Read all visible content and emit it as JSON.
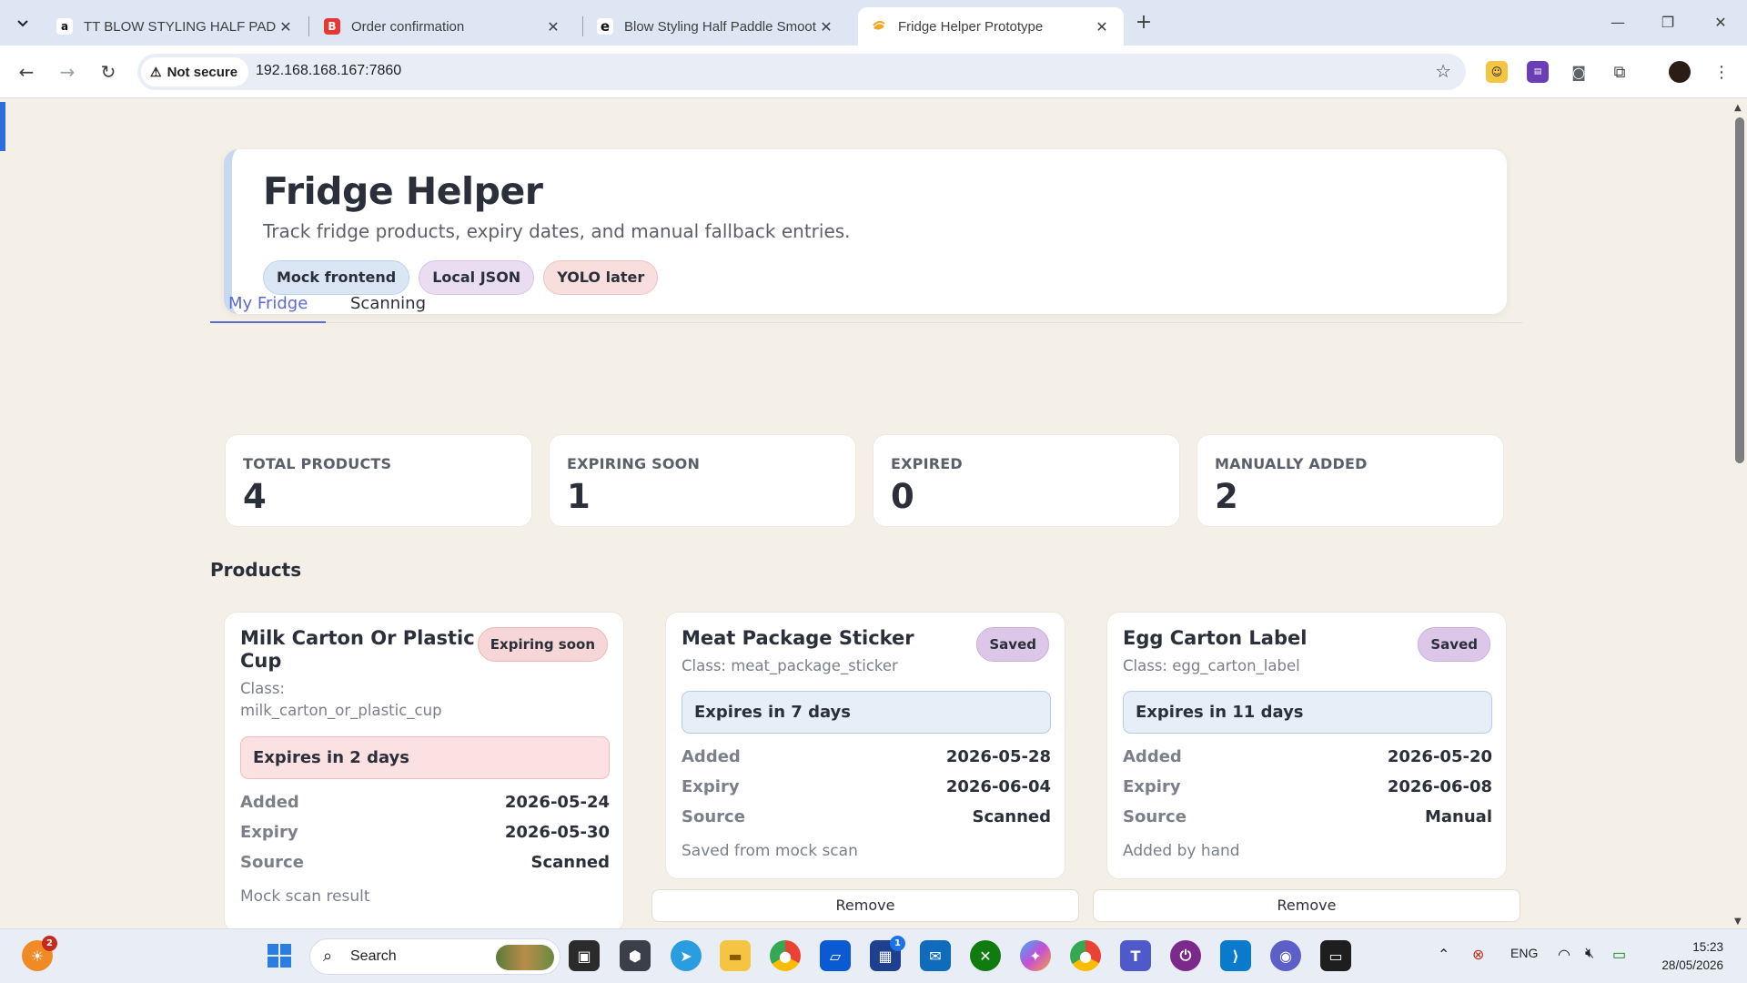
{
  "browser": {
    "tabs": [
      {
        "label": "TT BLOW STYLING HALF PADDLE",
        "favicon": "amazon-icon"
      },
      {
        "label": "Order confirmation",
        "favicon": "b-icon"
      },
      {
        "label": "Blow Styling Half Paddle Smoot",
        "favicon": "edge-icon"
      },
      {
        "label": "Fridge Helper Prototype",
        "favicon": "app-icon"
      }
    ],
    "security_label": "Not secure",
    "url": "192.168.168.167:7860"
  },
  "header": {
    "title": "Fridge Helper",
    "subtitle": "Track fridge products, expiry dates, and manual fallback entries.",
    "pills": [
      "Mock frontend",
      "Local JSON",
      "YOLO later"
    ]
  },
  "tabs": [
    "My Fridge",
    "Scanning"
  ],
  "stats": [
    {
      "label": "TOTAL PRODUCTS",
      "value": "4"
    },
    {
      "label": "EXPIRING SOON",
      "value": "1"
    },
    {
      "label": "EXPIRED",
      "value": "0"
    },
    {
      "label": "MANUALLY ADDED",
      "value": "2"
    }
  ],
  "products_heading": "Products",
  "products": [
    {
      "name": "Milk Carton Or Plastic Cup",
      "status": "Expiring soon",
      "class_label": "Class:",
      "class_value": "milk_carton_or_plastic_cup",
      "expires": "Expires in 2 days",
      "rows": [
        {
          "k": "Added",
          "v": "2026-05-24"
        },
        {
          "k": "Expiry",
          "v": "2026-05-30"
        },
        {
          "k": "Source",
          "v": "Scanned"
        }
      ],
      "note": "Mock scan result"
    },
    {
      "name": "Meat Package Sticker",
      "status": "Saved",
      "class_line": "Class: meat_package_sticker",
      "expires": "Expires in 7 days",
      "rows": [
        {
          "k": "Added",
          "v": "2026-05-28"
        },
        {
          "k": "Expiry",
          "v": "2026-06-04"
        },
        {
          "k": "Source",
          "v": "Scanned"
        }
      ],
      "note": "Saved from mock scan"
    },
    {
      "name": "Egg Carton Label",
      "status": "Saved",
      "class_line": "Class: egg_carton_label",
      "expires": "Expires in 11 days",
      "rows": [
        {
          "k": "Added",
          "v": "2026-05-20"
        },
        {
          "k": "Expiry",
          "v": "2026-06-08"
        },
        {
          "k": "Source",
          "v": "Manual"
        }
      ],
      "note": "Added by hand"
    }
  ],
  "remove_label": "Remove",
  "taskbar": {
    "search_label": "Search",
    "notification_count": "2",
    "store_badge": "1",
    "language": "ENG",
    "time": "15:23",
    "date": "28/05/2026"
  }
}
